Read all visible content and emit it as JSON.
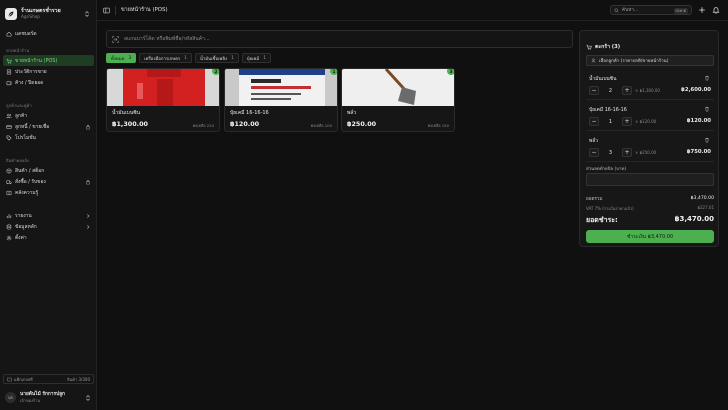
{
  "sidebar": {
    "brand_name": "ร้านเกษตรช่ำรวย",
    "brand_sub": "AgriShop",
    "dashboard": "แดชบอร์ด",
    "section_sales": "ขายหน้าร้าน",
    "pos": "ขายหน้าร้าน (POS)",
    "transactions": "ประวัติการขาย",
    "debtors": "ค้าง / ปิดยอด",
    "section_customers": "ลูกค้าและคู่ค้า",
    "customers": "ลูกค้า",
    "customer_debts": "ลูกหนี้ / ขายเชื่อ",
    "promotions": "โปรโมชั่น",
    "section_inventory": "สินค้าคงคลัง",
    "products": "สินค้า / สต็อก",
    "purchases": "สั่งซื้อ / รับของ",
    "knowledge": "คลังความรู้",
    "reports": "รายงาน",
    "master_data": "ข้อมูลหลัก",
    "settings": "ตั้งค่า",
    "trial_label": "แพ็กเกจฟรี",
    "trial_value": "สินค้า 3/300",
    "user_initials": "นร",
    "user_name": "นายต้นไม้ รักการปลูก",
    "user_role": "เจ้าของร้าน"
  },
  "topbar": {
    "title": "ขายหน้าร้าน (POS)",
    "search_placeholder": "ค้นหา...",
    "shortcut": "Ctrl K"
  },
  "scan": {
    "placeholder": "สแกนบาร์โค้ด หรือพิมพ์ชื่อ/รหัสสินค้า..."
  },
  "categories": [
    {
      "label": "ทั้งหมด",
      "count": "3"
    },
    {
      "label": "เครื่องมือการเกษตร",
      "count": "1"
    },
    {
      "label": "น้ำมันเชื้อเพลิง",
      "count": "1"
    },
    {
      "label": "ปุ๋ยเคมี",
      "count": "1"
    }
  ],
  "products": [
    {
      "name": "น้ำมันเบนซิน",
      "price": "฿1,300.00",
      "stock": "คงเหลือ 220",
      "in_cart": "2"
    },
    {
      "name": "ปุ๋ยเคมี 16-16-16",
      "price": "฿120.00",
      "stock": "คงเหลือ 100",
      "in_cart": "1"
    },
    {
      "name": "พลั่ว",
      "price": "฿250.00",
      "stock": "คงเหลือ 150",
      "in_cart": "3"
    }
  ],
  "cart": {
    "title": "ตะกร้า (3)",
    "customer": "เลือกลูกค้า (ราคาปกติ/ขายหน้าร้าน)",
    "items": [
      {
        "name": "น้ำมันเบนซิน",
        "qty": "2",
        "unit": "× ฿1,300.00",
        "line": "฿2,600.00"
      },
      {
        "name": "ปุ๋ยเคมี 16-16-16",
        "qty": "1",
        "unit": "× ฿120.00",
        "line": "฿120.00"
      },
      {
        "name": "พลั่ว",
        "qty": "3",
        "unit": "× ฿250.00",
        "line": "฿750.00"
      }
    ],
    "discount_label": "ส่วนลดท้ายบิล (บาท)",
    "subtotal_label": "ยอดรวม",
    "subtotal": "฿3,470.00",
    "vat_label": "VAT 7% (รวมในราคาแล้ว)",
    "vat": "฿227.01",
    "total_label": "ยอดชำระ:",
    "total": "฿3,470.00",
    "pay_label": "ชำระเงิน ฿3,470.00"
  },
  "colors": {
    "accent": "#4caf50",
    "active_nav_bg": "#1f3d22",
    "background": "#101010"
  }
}
